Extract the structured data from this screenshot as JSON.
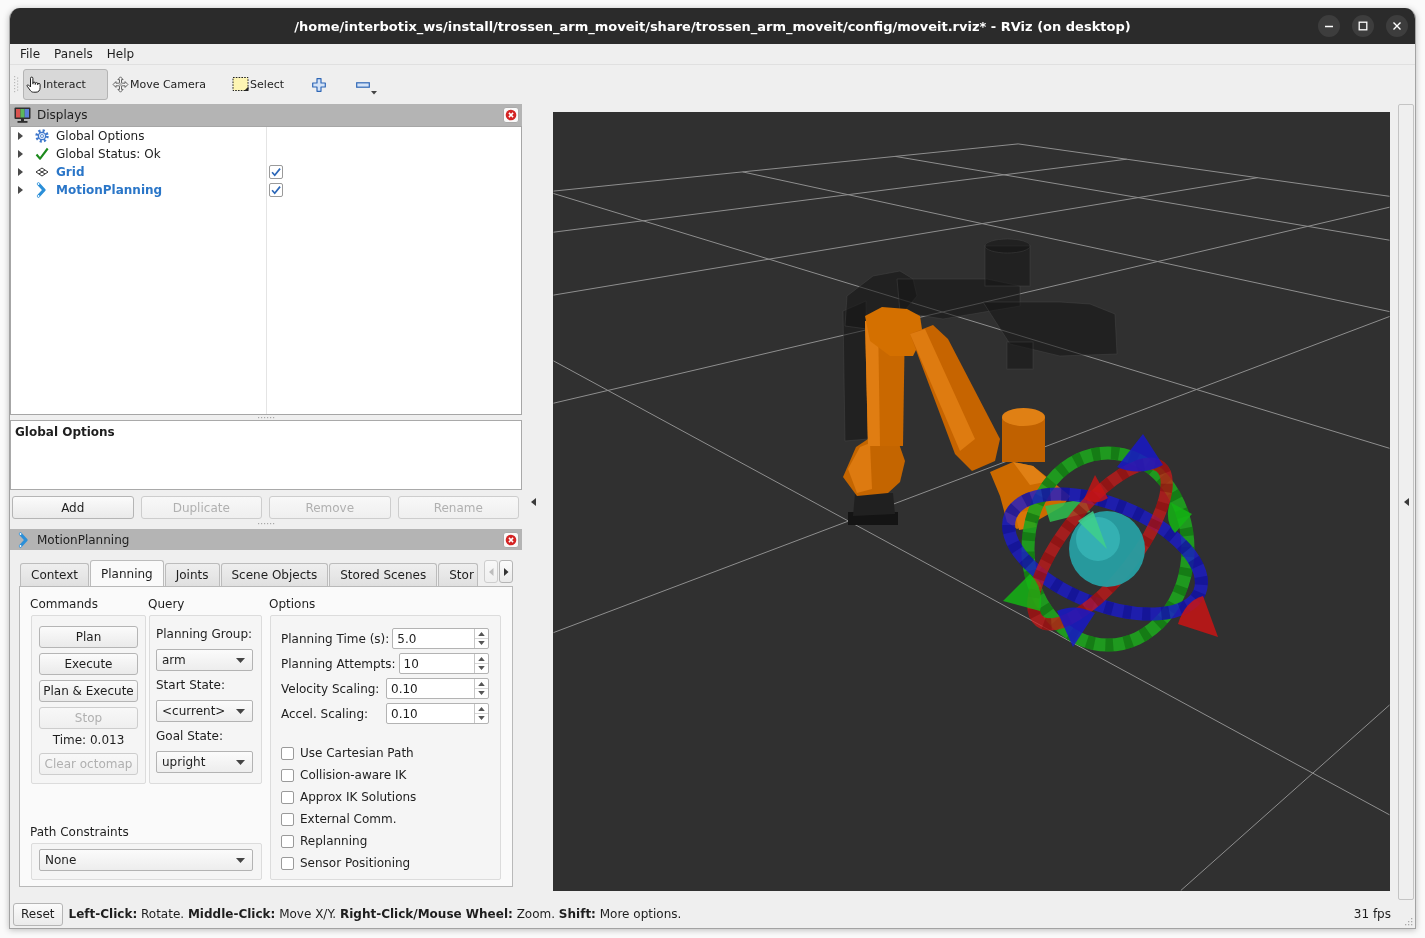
{
  "window": {
    "title": "/home/interbotix_ws/install/trossen_arm_moveit/share/trossen_arm_moveit/config/moveit.rviz* - RViz (on desktop)"
  },
  "menu": [
    "File",
    "Panels",
    "Help"
  ],
  "toolbar": {
    "tools": [
      {
        "kind": "interact",
        "label": "Interact",
        "selected": true
      },
      {
        "kind": "move_camera",
        "label": "Move Camera",
        "selected": false
      },
      {
        "kind": "select",
        "label": "Select",
        "selected": false
      }
    ]
  },
  "displays": {
    "title": "Displays",
    "items": [
      {
        "kind": "global_options",
        "label": "Global Options",
        "expanded": false
      },
      {
        "kind": "global_status",
        "label": "Global Status: Ok",
        "expanded": false
      },
      {
        "kind": "grid",
        "label": "Grid",
        "expanded": false,
        "checked": true
      },
      {
        "kind": "motion_planning",
        "label": "MotionPlanning",
        "expanded": false,
        "checked": true
      }
    ],
    "description": {
      "title": "Global Options"
    },
    "buttons": [
      {
        "label": "Add",
        "disabled": false
      },
      {
        "label": "Duplicate",
        "disabled": true
      },
      {
        "label": "Remove",
        "disabled": true
      },
      {
        "label": "Rename",
        "disabled": true
      }
    ]
  },
  "motion_planning": {
    "title": "MotionPlanning",
    "tabs": [
      {
        "label": "Context",
        "selected": false
      },
      {
        "label": "Planning",
        "selected": true
      },
      {
        "label": "Joints",
        "selected": false
      },
      {
        "label": "Scene Objects",
        "selected": false
      },
      {
        "label": "Stored Scenes",
        "selected": false
      },
      {
        "label": "Stor",
        "selected": false
      }
    ],
    "tab_scroll": [
      {
        "kind": "left",
        "disabled": true
      },
      {
        "kind": "right",
        "disabled": false
      }
    ],
    "commands": {
      "title": "Commands",
      "items": [
        {
          "kind": "button",
          "label": "Plan",
          "disabled": false
        },
        {
          "kind": "button",
          "label": "Execute",
          "disabled": false
        },
        {
          "kind": "button",
          "label": "Plan & Execute",
          "disabled": false
        },
        {
          "kind": "button",
          "label": "Stop",
          "disabled": true
        },
        {
          "kind": "text",
          "label": "Time: 0.013"
        },
        {
          "kind": "button",
          "label": "Clear octomap",
          "disabled": true
        }
      ]
    },
    "query": {
      "title": "Query",
      "fields": [
        {
          "label": "Planning Group:",
          "value": "arm"
        },
        {
          "label": "Start State:",
          "value": "<current>"
        },
        {
          "label": "Goal State:",
          "value": "upright"
        }
      ]
    },
    "options": {
      "title": "Options",
      "spinboxes": [
        {
          "label": "Planning Time (s):",
          "value": "5.0"
        },
        {
          "label": "Planning Attempts:",
          "value": "10"
        },
        {
          "label": "Velocity Scaling:",
          "value": "0.10"
        },
        {
          "label": "Accel. Scaling:",
          "value": "0.10"
        }
      ],
      "checkboxes": [
        {
          "label": "Use Cartesian Path",
          "checked": false
        },
        {
          "label": "Collision-aware IK",
          "checked": false
        },
        {
          "label": "Approx IK Solutions",
          "checked": false
        },
        {
          "label": "External Comm.",
          "checked": false
        },
        {
          "label": "Replanning",
          "checked": false
        },
        {
          "label": "Sensor Positioning",
          "checked": false
        }
      ]
    },
    "path_constraints": {
      "title": "Path Constraints",
      "value": "None"
    }
  },
  "status_bar": {
    "reset": "Reset",
    "hint": "**Left-Click:** Rotate. **Middle-Click:** Move X/Y. **Right-Click/Mouse Wheel:** Zoom. **Shift:** More options.",
    "fps": "31 fps"
  }
}
